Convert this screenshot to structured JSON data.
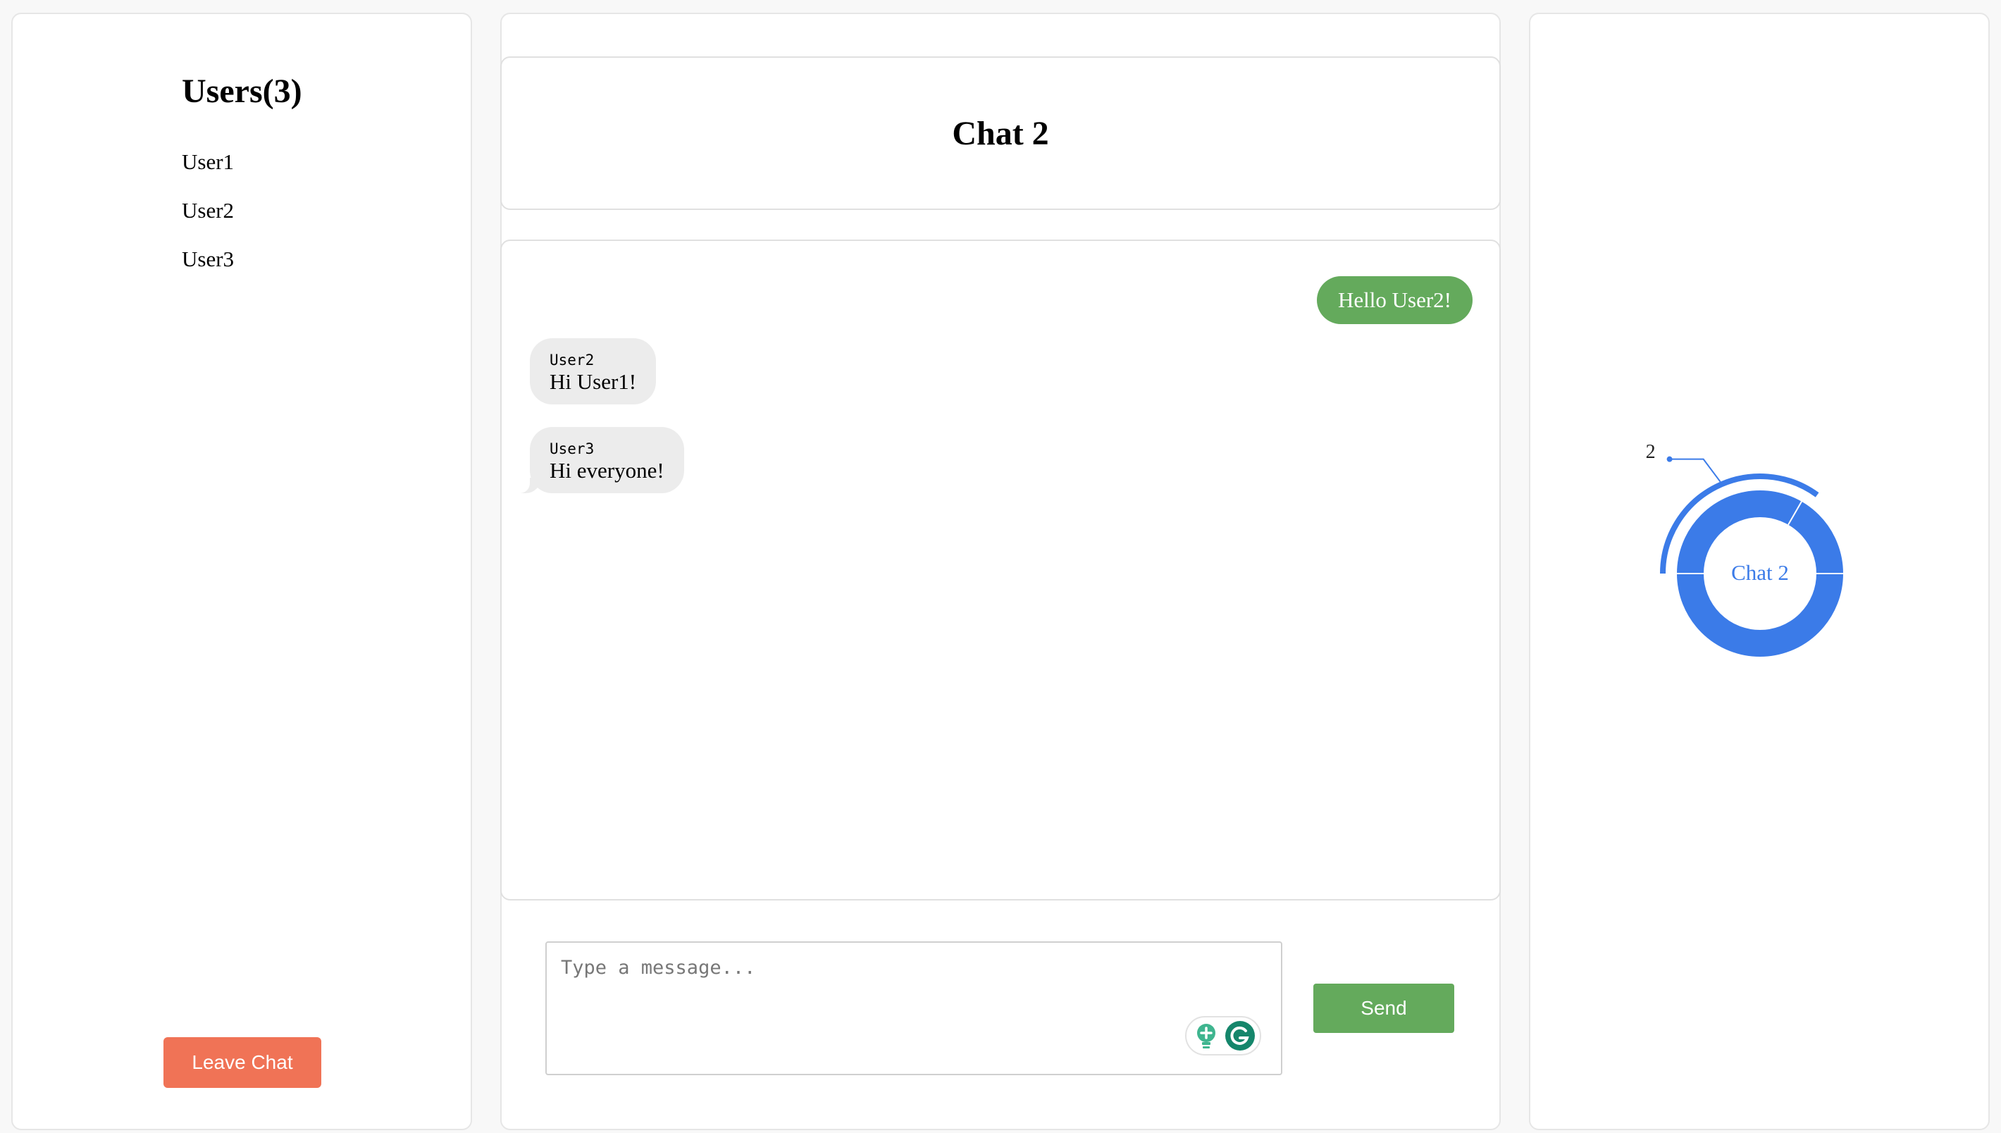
{
  "users": {
    "title": "Users(3)",
    "items": [
      {
        "name": "User1"
      },
      {
        "name": "User2"
      },
      {
        "name": "User3"
      }
    ],
    "leave_label": "Leave Chat"
  },
  "chat": {
    "title": "Chat 2",
    "messages": [
      {
        "direction": "out",
        "text": "Hello User2!"
      },
      {
        "direction": "in",
        "sender": "User2",
        "text": "Hi User1!"
      },
      {
        "direction": "in",
        "sender": "User3",
        "text": "Hi everyone!"
      }
    ],
    "input": {
      "value": "",
      "placeholder": "Type a message..."
    },
    "send_label": "Send"
  },
  "colors": {
    "accent_green": "#64aa5c",
    "leave_red": "#f07356",
    "chart_blue": "#3b7be8",
    "incoming_bubble": "#ececec"
  },
  "chart_data": {
    "type": "pie",
    "categories": [
      "Chat 2"
    ],
    "values": [
      2
    ],
    "center_label": "Chat 2",
    "slice_labels": [
      "2"
    ],
    "inner_ring": true
  }
}
